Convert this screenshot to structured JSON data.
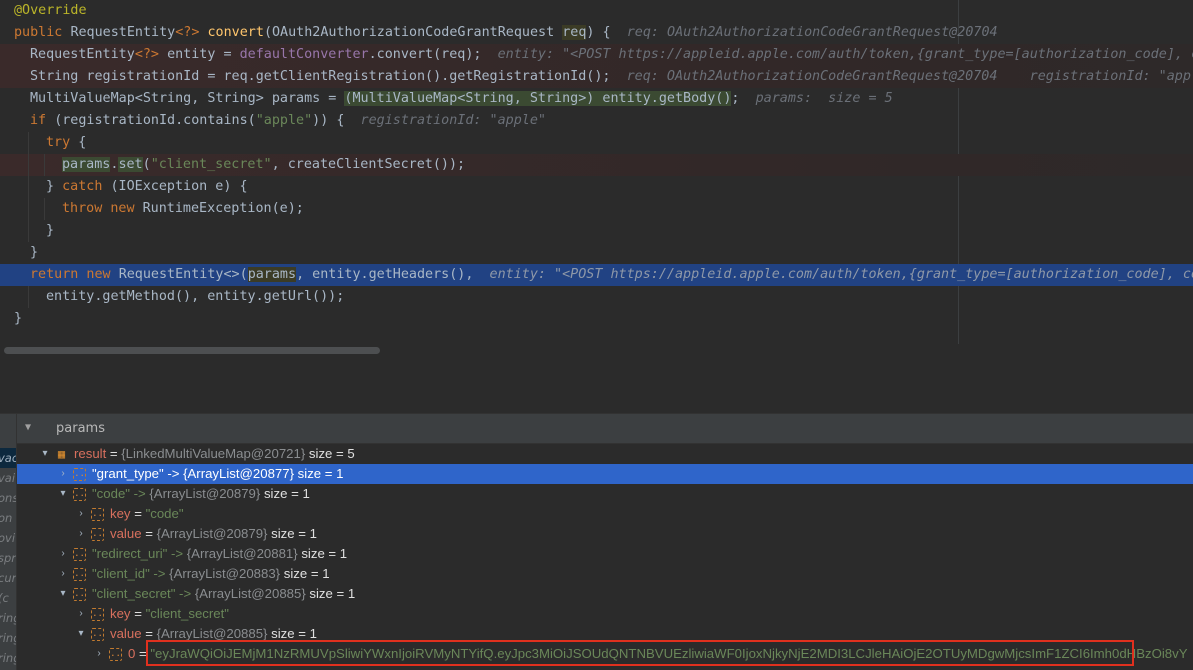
{
  "editor": {
    "lines": [
      {
        "indent": 14,
        "parts": [
          [
            "an",
            "@Override"
          ]
        ]
      },
      {
        "indent": 14,
        "parts": [
          [
            "kw",
            "public "
          ],
          [
            "p",
            "RequestEntity"
          ],
          [
            "kw",
            "<?> "
          ],
          [
            "fn",
            "convert"
          ],
          [
            "p",
            "(OAuth2AuthorizationCodeGrantRequest "
          ],
          [
            "hl",
            "req"
          ],
          [
            "p",
            ") {  "
          ],
          [
            "hint",
            "req: OAuth2AuthorizationCodeGrantRequest@20704"
          ]
        ]
      },
      {
        "indent": 30,
        "err": true,
        "parts": [
          [
            "p",
            "RequestEntity"
          ],
          [
            "kw",
            "<?> "
          ],
          [
            "p",
            "entity = "
          ],
          [
            "fld",
            "defaultConverter"
          ],
          [
            "p",
            ".convert(req);  "
          ],
          [
            "hint",
            "entity: \"<POST https://appleid.apple.com/auth/token,{grant_type=[authorization_code], c"
          ]
        ]
      },
      {
        "indent": 30,
        "err": true,
        "parts": [
          [
            "p",
            "String registrationId = req.getClientRegistration().getRegistrationId();  "
          ],
          [
            "hint",
            "req: OAuth2AuthorizationCodeGrantRequest@20704    registrationId: \"apple"
          ]
        ]
      },
      {
        "indent": 30,
        "parts": [
          [
            "p",
            "MultiValueMap<String, String> params = "
          ],
          [
            "hlp",
            "(MultiValueMap<String, String>) entity.getBody()"
          ],
          [
            "p",
            ";  "
          ],
          [
            "hint",
            "params:  size = 5"
          ]
        ]
      },
      {
        "indent": 30,
        "parts": [
          [
            "kw",
            "if "
          ],
          [
            "p",
            "(registrationId.contains("
          ],
          [
            "str",
            "\"apple\""
          ],
          [
            "p",
            ")) {  "
          ],
          [
            "hint",
            "registrationId: \"apple\""
          ]
        ]
      },
      {
        "indent": 46,
        "parts": [
          [
            "kw",
            "try "
          ],
          [
            "p",
            "{"
          ]
        ]
      },
      {
        "indent": 62,
        "err": true,
        "parts": [
          [
            "hlp",
            "params"
          ],
          [
            "p",
            "."
          ],
          [
            "hlp",
            "set"
          ],
          [
            "p",
            "("
          ],
          [
            "str",
            "\"client_secret\""
          ],
          [
            "p",
            ", createClientSecret());"
          ]
        ]
      },
      {
        "indent": 46,
        "parts": [
          [
            "p",
            "} "
          ],
          [
            "kw",
            "catch "
          ],
          [
            "p",
            "(IOException e) {"
          ]
        ]
      },
      {
        "indent": 62,
        "parts": [
          [
            "kw",
            "throw new "
          ],
          [
            "p",
            "RuntimeException(e);"
          ]
        ]
      },
      {
        "indent": 46,
        "parts": [
          [
            "p",
            "}"
          ]
        ]
      },
      {
        "indent": 30,
        "parts": [
          [
            "p",
            "}"
          ]
        ]
      },
      {
        "indent": 30,
        "cur": true,
        "parts": [
          [
            "kw",
            "return new "
          ],
          [
            "p",
            "RequestEntity<>("
          ],
          [
            "hl",
            "params"
          ],
          [
            "p",
            ", entity.getHeaders(),  "
          ],
          [
            "hint",
            "entity: \"<POST https://appleid.apple.com/auth/token,{grant_type=[authorization_code], co"
          ]
        ]
      },
      {
        "indent": 46,
        "parts": [
          [
            "p",
            "entity.getMethod(), entity.getUrl());"
          ]
        ]
      },
      {
        "indent": 14,
        "parts": [
          [
            "p",
            "}"
          ]
        ]
      }
    ]
  },
  "debugger": {
    "panel_title": "params",
    "frames": [
      "vac",
      "vai",
      "ons",
      "on",
      "ovi",
      "spr",
      "cur",
      "(c",
      "ring",
      "ring",
      "ring"
    ],
    "tree": [
      {
        "level": 0,
        "toggle": "▾",
        "icon": "grid",
        "name": "result",
        "eq": " = ",
        "quoted": "",
        "ref": "{LinkedMultiValueMap@20721}",
        "size": "  size = 5",
        "selected": false
      },
      {
        "level": 1,
        "toggle": "›",
        "icon": "obj",
        "name": "",
        "eq": "",
        "quoted": "\"grant_type\" -> ",
        "ref": "{ArrayList@20877}",
        "size": "  size = 1",
        "selected": true
      },
      {
        "level": 1,
        "toggle": "▾",
        "icon": "obj",
        "name": "",
        "eq": "",
        "quoted": "\"code\" -> ",
        "ref": "{ArrayList@20879}",
        "size": "  size = 1",
        "selected": false
      },
      {
        "level": 2,
        "toggle": "›",
        "icon": "obj",
        "name": "key",
        "eq": " = ",
        "quoted": "\"code\"",
        "ref": "",
        "size": "",
        "selected": false
      },
      {
        "level": 2,
        "toggle": "›",
        "icon": "obj",
        "name": "value",
        "eq": " = ",
        "quoted": "",
        "ref": "{ArrayList@20879}",
        "size": "  size = 1",
        "selected": false
      },
      {
        "level": 1,
        "toggle": "›",
        "icon": "obj",
        "name": "",
        "eq": "",
        "quoted": "\"redirect_uri\" -> ",
        "ref": "{ArrayList@20881}",
        "size": "  size = 1",
        "selected": false
      },
      {
        "level": 1,
        "toggle": "›",
        "icon": "obj",
        "name": "",
        "eq": "",
        "quoted": "\"client_id\" -> ",
        "ref": "{ArrayList@20883}",
        "size": "  size = 1",
        "selected": false
      },
      {
        "level": 1,
        "toggle": "▾",
        "icon": "obj",
        "name": "",
        "eq": "",
        "quoted": "\"client_secret\" -> ",
        "ref": "{ArrayList@20885}",
        "size": "  size = 1",
        "selected": false
      },
      {
        "level": 2,
        "toggle": "›",
        "icon": "obj",
        "name": "key",
        "eq": " = ",
        "quoted": "\"client_secret\"",
        "ref": "",
        "size": "",
        "selected": false
      },
      {
        "level": 2,
        "toggle": "▾",
        "icon": "obj",
        "name": "value",
        "eq": " = ",
        "quoted": "",
        "ref": "{ArrayList@20885}",
        "size": "  size = 1",
        "selected": false
      },
      {
        "level": 3,
        "toggle": "›",
        "icon": "obj",
        "name": "0",
        "eq": " = ",
        "quoted": "\"eyJraWQiOiJEMjM1NzRMUVpSliwiYWxnIjoiRVMyNTYifQ.eyJpc3MiOiJSOUdQNTNBVUEzliwiaWF0IjoxNjkyNjE2MDI3LCJleHAiOjE2OTUyMDgwMjcsImF1ZCI6Imh0dHBzOi8vY",
        "ref": "",
        "size": "",
        "selected": false
      }
    ]
  },
  "colors": {
    "selection": "#2f65ca",
    "current_line": "#214283",
    "highlight_box": "#e0301e"
  }
}
